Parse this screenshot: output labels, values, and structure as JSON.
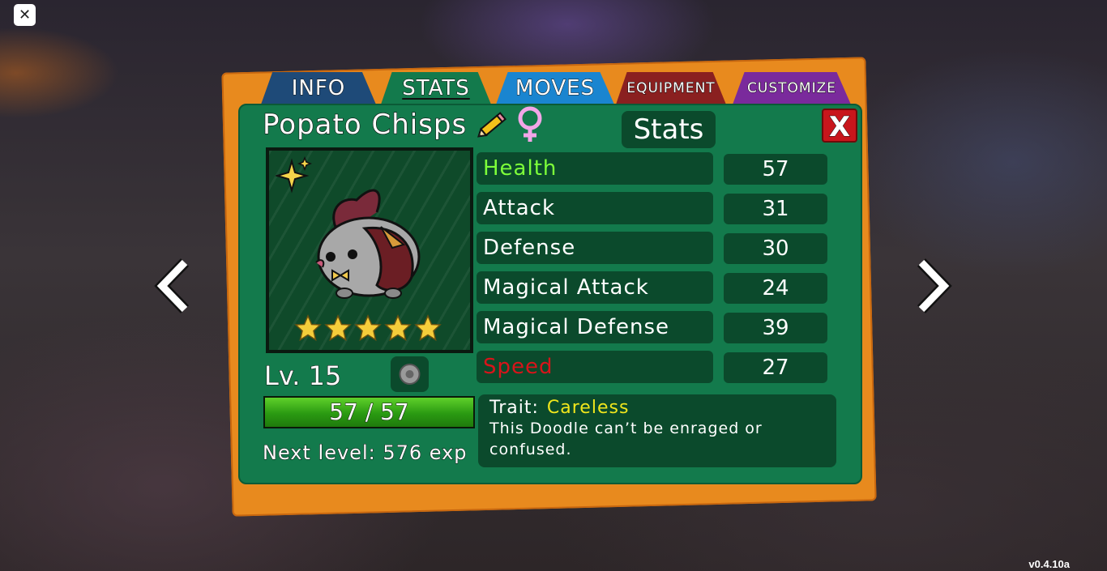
{
  "app": {
    "close_glyph": "✕",
    "version": "v0.4.10a"
  },
  "tabs": [
    {
      "label": "INFO",
      "color": "#1e4a78"
    },
    {
      "label": "STATS",
      "color": "#137a4c",
      "active": true
    },
    {
      "label": "MOVES",
      "color": "#1a85d0"
    },
    {
      "label": "EQUIPMENT",
      "color": "#8a2020"
    },
    {
      "label": "CUSTOMIZE",
      "color": "#7a2a9c"
    }
  ],
  "doodle": {
    "name": "Popato Chisps",
    "gender": "female",
    "star_rating": 5,
    "level_label": "Lv. 15",
    "hp": {
      "current": 57,
      "max": 57,
      "text": "57 / 57"
    },
    "next_level_text": "Next level: 576 exp",
    "shiny": true
  },
  "stats_panel": {
    "heading": "Stats",
    "close_label": "X",
    "rows": [
      {
        "name": "Health",
        "value": "57",
        "color": "#7dff3a"
      },
      {
        "name": "Attack",
        "value": "31",
        "color": "#ffffff"
      },
      {
        "name": "Defense",
        "value": "30",
        "color": "#ffffff"
      },
      {
        "name": "Magical Attack",
        "value": "24",
        "color": "#ffffff"
      },
      {
        "name": "Magical Defense",
        "value": "39",
        "color": "#ffffff"
      },
      {
        "name": "Speed",
        "value": "27",
        "color": "#d8141a"
      }
    ]
  },
  "trait": {
    "label": "Trait:",
    "name": "Careless",
    "description": "This Doodle can’t be enraged or confused."
  },
  "icons": {
    "edit": "pencil-icon",
    "gender": "female-icon",
    "shiny": "sparkle-icon",
    "item": "item-slot-icon",
    "prev": "chevron-left-icon",
    "next": "chevron-right-icon"
  }
}
